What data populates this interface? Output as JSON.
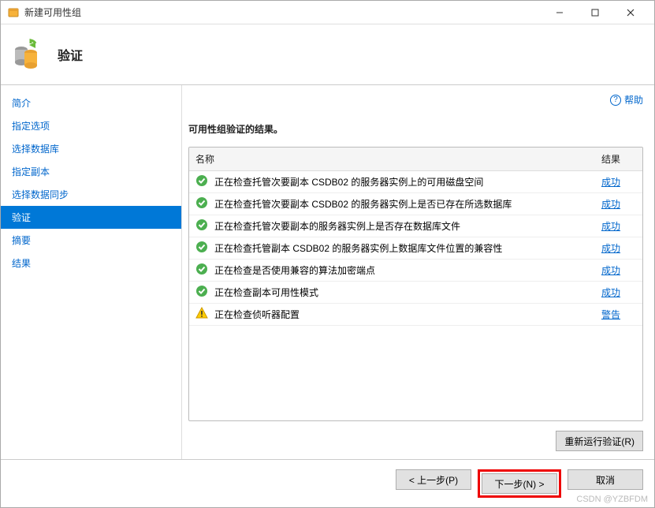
{
  "titlebar": {
    "title": "新建可用性组"
  },
  "header": {
    "title": "验证"
  },
  "help": {
    "label": "帮助"
  },
  "sidebar": {
    "items": [
      {
        "label": "简介"
      },
      {
        "label": "指定选项"
      },
      {
        "label": "选择数据库"
      },
      {
        "label": "指定副本"
      },
      {
        "label": "选择数据同步"
      },
      {
        "label": "验证"
      },
      {
        "label": "摘要"
      },
      {
        "label": "结果"
      }
    ],
    "active_index": 5
  },
  "content": {
    "subtitle": "可用性组验证的结果。",
    "columns": {
      "name": "名称",
      "result": "结果"
    },
    "rows": [
      {
        "status": "success",
        "name": "正在检查托管次要副本 CSDB02 的服务器实例上的可用磁盘空间",
        "result": "成功"
      },
      {
        "status": "success",
        "name": "正在检查托管次要副本 CSDB02 的服务器实例上是否已存在所选数据库",
        "result": "成功"
      },
      {
        "status": "success",
        "name": "正在检查托管次要副本的服务器实例上是否存在数据库文件",
        "result": "成功"
      },
      {
        "status": "success",
        "name": "正在检查托管副本 CSDB02 的服务器实例上数据库文件位置的兼容性",
        "result": "成功"
      },
      {
        "status": "success",
        "name": "正在检查是否使用兼容的算法加密端点",
        "result": "成功"
      },
      {
        "status": "success",
        "name": "正在检查副本可用性模式",
        "result": "成功"
      },
      {
        "status": "warning",
        "name": "正在检查侦听器配置",
        "result": "警告"
      }
    ],
    "rerun_label": "重新运行验证(R)"
  },
  "footer": {
    "prev": "< 上一步(P)",
    "next": "下一步(N) >",
    "cancel": "取消"
  },
  "watermark": "CSDN @YZBFDM"
}
